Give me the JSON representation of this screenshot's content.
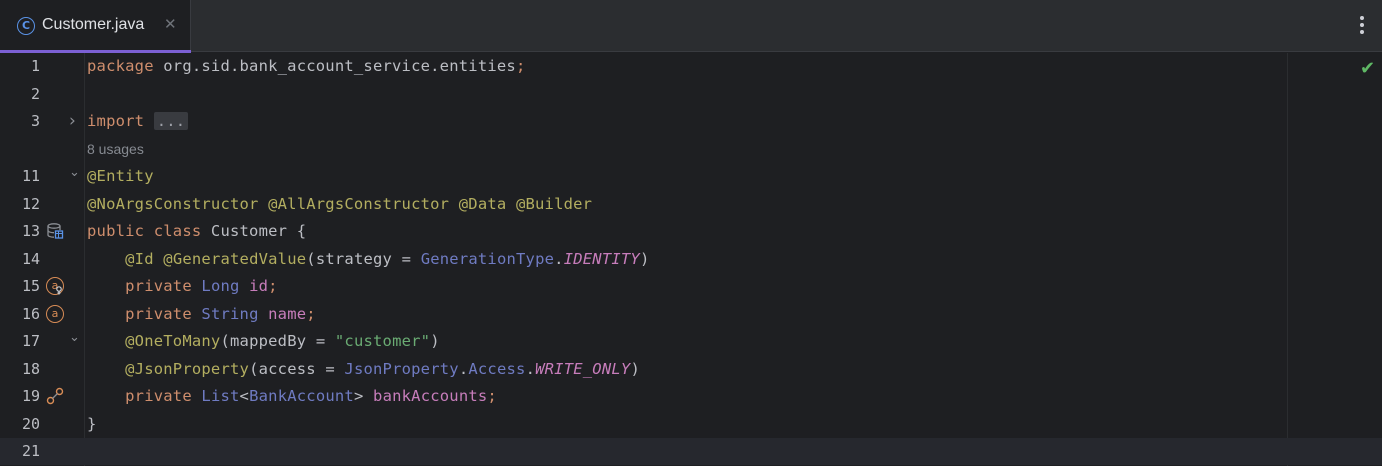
{
  "tabs": [
    {
      "label": "Customer.java",
      "icon": "java-class-icon",
      "active": true
    }
  ],
  "editor": {
    "status": "no-problems-check",
    "inlay_hint": "8 usages",
    "lines": [
      {
        "num": "1",
        "tokens": [
          [
            "kw",
            "package "
          ],
          [
            "pkg",
            "org.sid.bank_account_service.entities"
          ],
          [
            "semi",
            ";"
          ]
        ]
      },
      {
        "num": "2",
        "tokens": []
      },
      {
        "num": "3",
        "fold": "collapsed",
        "tokens": [
          [
            "kw",
            "import "
          ],
          [
            "dots",
            "..."
          ]
        ]
      },
      {
        "num": "11",
        "fold": "expanded",
        "tokens": [
          [
            "ann",
            "@Entity"
          ]
        ]
      },
      {
        "num": "12",
        "tokens": [
          [
            "ann",
            "@NoArgsConstructor "
          ],
          [
            "ann",
            "@AllArgsConstructor "
          ],
          [
            "ann",
            "@Data "
          ],
          [
            "ann",
            "@Builder"
          ]
        ]
      },
      {
        "num": "13",
        "marker": "database-entity-icon",
        "tokens": [
          [
            "kw",
            "public class "
          ],
          [
            "cls",
            "Customer "
          ],
          [
            "plain",
            "{"
          ]
        ]
      },
      {
        "num": "14",
        "tokens": [
          [
            "plain",
            "    "
          ],
          [
            "ann",
            "@Id "
          ],
          [
            "ann",
            "@GeneratedValue"
          ],
          [
            "plain",
            "("
          ],
          [
            "param",
            "strategy "
          ],
          [
            "plain",
            "= "
          ],
          [
            "ref",
            "GenerationType"
          ],
          [
            "plain",
            "."
          ],
          [
            "const",
            "IDENTITY"
          ],
          [
            "plain",
            ")"
          ]
        ]
      },
      {
        "num": "15",
        "marker": "id-field-icon",
        "tokens": [
          [
            "plain",
            "    "
          ],
          [
            "kw",
            "private "
          ],
          [
            "ref",
            "Long "
          ],
          [
            "fld",
            "id"
          ],
          [
            "semi",
            ";"
          ]
        ]
      },
      {
        "num": "16",
        "marker": "field-icon",
        "tokens": [
          [
            "plain",
            "    "
          ],
          [
            "kw",
            "private "
          ],
          [
            "ref",
            "String "
          ],
          [
            "fld",
            "name"
          ],
          [
            "semi",
            ";"
          ]
        ]
      },
      {
        "num": "17",
        "fold": "expanded",
        "tokens": [
          [
            "plain",
            "    "
          ],
          [
            "ann",
            "@OneToMany"
          ],
          [
            "plain",
            "("
          ],
          [
            "param",
            "mappedBy "
          ],
          [
            "plain",
            "= "
          ],
          [
            "str",
            "\"customer\""
          ],
          [
            "plain",
            ")"
          ]
        ]
      },
      {
        "num": "18",
        "tokens": [
          [
            "plain",
            "    "
          ],
          [
            "ann",
            "@JsonProperty"
          ],
          [
            "plain",
            "("
          ],
          [
            "param",
            "access "
          ],
          [
            "plain",
            "= "
          ],
          [
            "ref",
            "JsonProperty"
          ],
          [
            "plain",
            "."
          ],
          [
            "ref",
            "Access"
          ],
          [
            "plain",
            "."
          ],
          [
            "const",
            "WRITE_ONLY"
          ],
          [
            "plain",
            ")"
          ]
        ]
      },
      {
        "num": "19",
        "marker": "relationship-icon",
        "tokens": [
          [
            "plain",
            "    "
          ],
          [
            "kw",
            "private "
          ],
          [
            "ref",
            "List"
          ],
          [
            "plain",
            "<"
          ],
          [
            "ref",
            "BankAccount"
          ],
          [
            "plain",
            "> "
          ],
          [
            "fld",
            "bankAccounts"
          ],
          [
            "semi",
            ";"
          ]
        ]
      },
      {
        "num": "20",
        "tokens": [
          [
            "plain",
            "}"
          ]
        ]
      },
      {
        "num": "21",
        "current": true,
        "tokens": []
      }
    ]
  }
}
